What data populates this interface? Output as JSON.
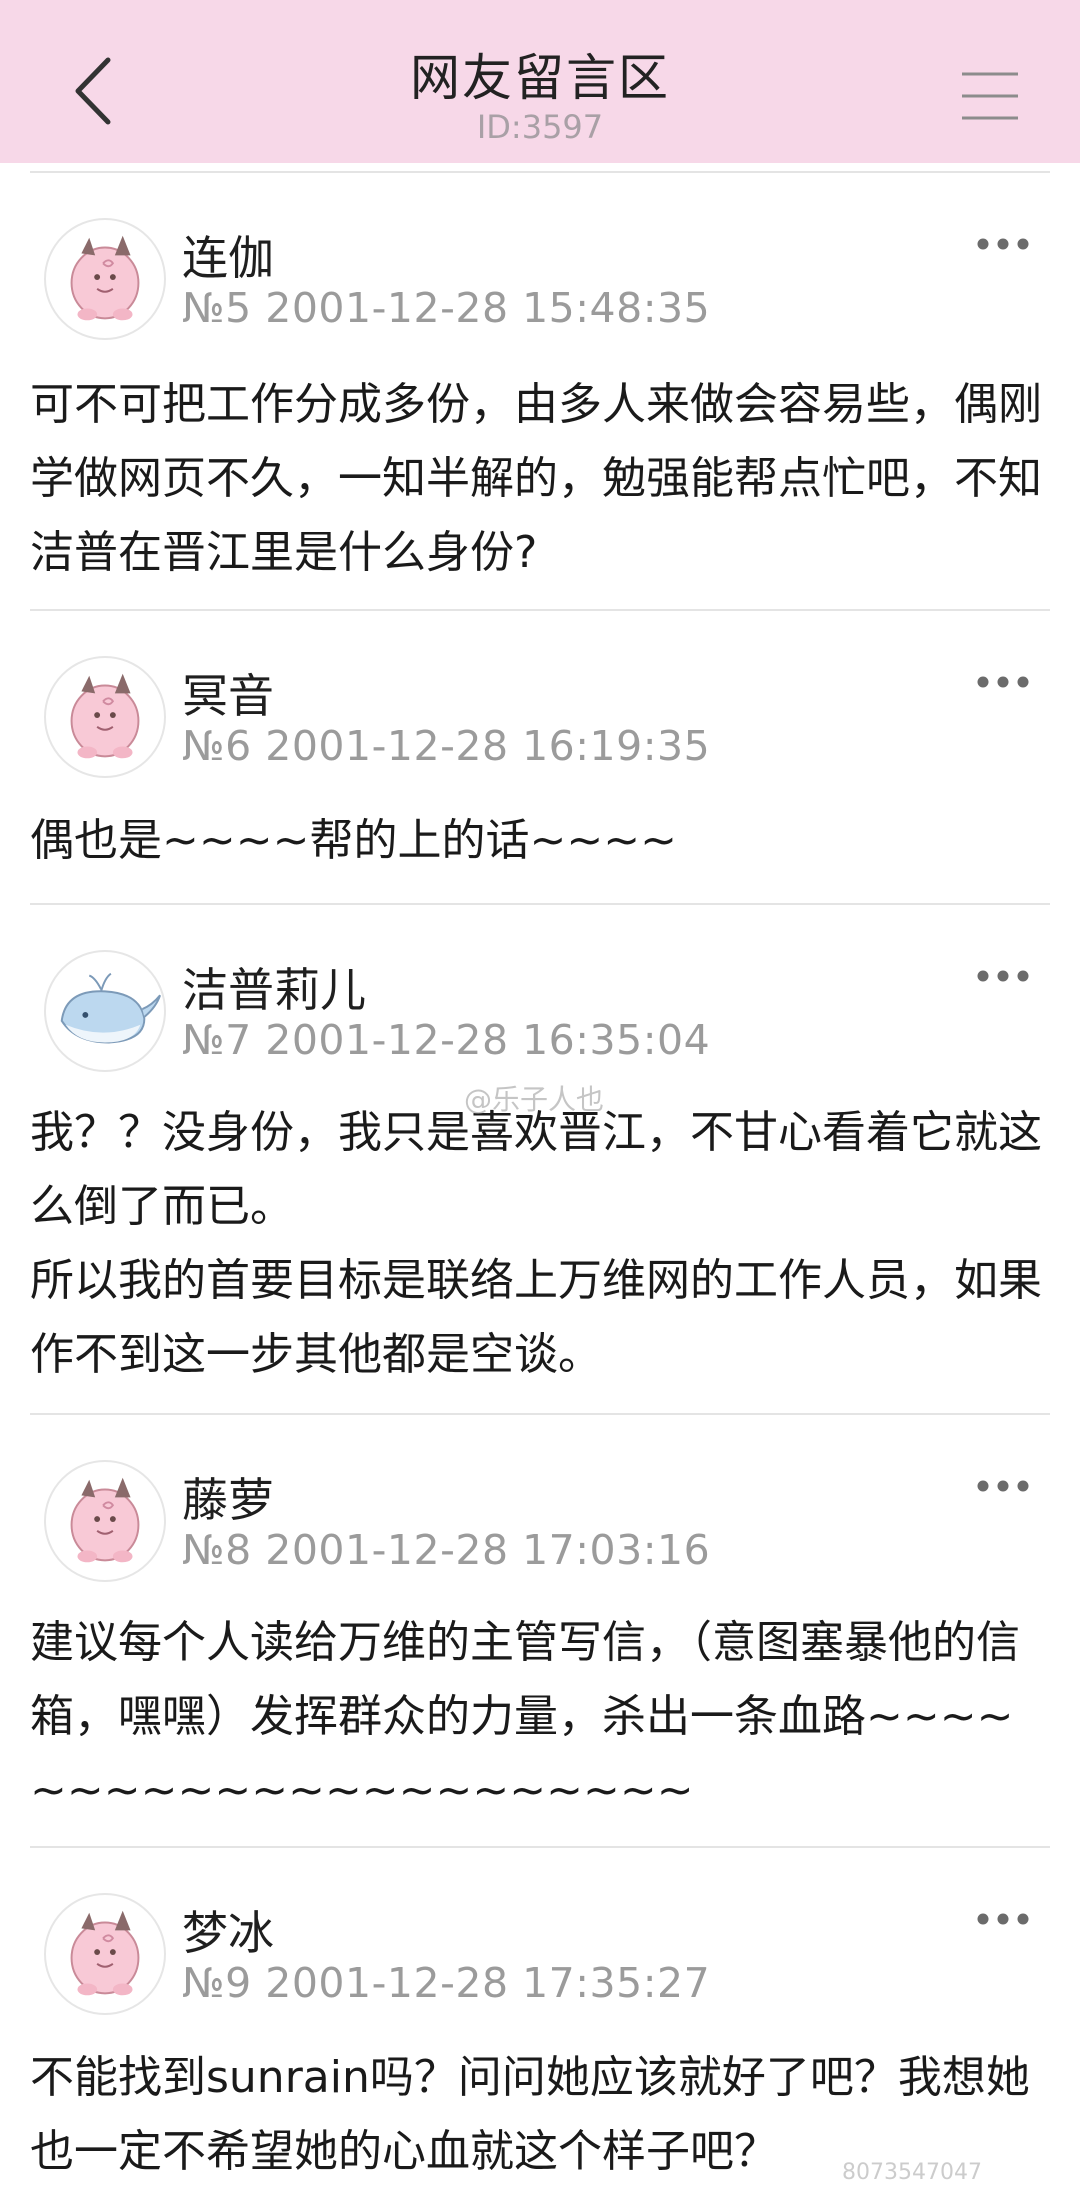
{
  "header": {
    "title": "网友留言区",
    "id_label": "ID:3597",
    "background": "#f7d8e8"
  },
  "posts": [
    {
      "author": "连伽",
      "meta": "№5 2001-12-28 15:48:35",
      "avatar": "pink-creature-icon",
      "content": "可不可把工作分成多份，由多人来做会容易些，偶刚学做网页不久，一知半解的，勉强能帮点忙吧，不知洁普在晋江里是什么身份?"
    },
    {
      "author": "冥音",
      "meta": "№6 2001-12-28 16:19:35",
      "avatar": "pink-creature-icon",
      "content": "偶也是~~~~帮的上的话~~~~"
    },
    {
      "author": "洁普莉儿",
      "meta": "№7 2001-12-28 16:35:04",
      "avatar": "blue-whale-icon",
      "content": "我？？没身份，我只是喜欢晋江，不甘心看着它就这么倒了而已。\n所以我的首要目标是联络上万维网的工作人员，如果作不到这一步其他都是空谈。"
    },
    {
      "author": "藤萝",
      "meta": "№8 2001-12-28 17:03:16",
      "avatar": "pink-creature-icon",
      "content": "建议每个人读给万维的主管写信，（意图塞暴他的信箱，嘿嘿）发挥群众的力量，杀出一条血路~~~~~~~~~~~~~~~~~~~~~~"
    },
    {
      "author": "梦冰",
      "meta": "№9 2001-12-28 17:35:27",
      "avatar": "pink-creature-icon",
      "content": "不能找到sunrain吗？问问她应该就好了吧？我想她也一定不希望她的心血就这个样子吧？"
    }
  ],
  "watermarks": {
    "weibo": "@乐子人也",
    "corner": "8073547047"
  }
}
